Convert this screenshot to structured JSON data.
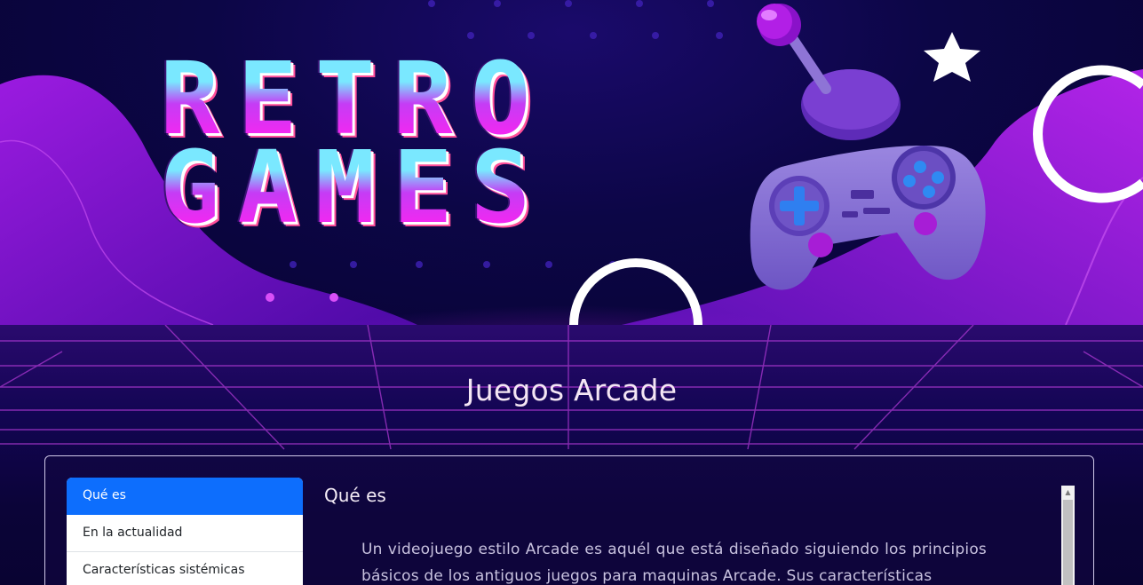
{
  "hero": {
    "logo_line1": "RETRO",
    "logo_line2": "GAMES"
  },
  "section": {
    "title": "Juegos Arcade"
  },
  "sidebar": {
    "items": [
      {
        "label": "Qué es",
        "active": true
      },
      {
        "label": "En la actualidad",
        "active": false
      },
      {
        "label": "Características sistémicas",
        "active": false
      }
    ]
  },
  "content": {
    "heading": "Qué es",
    "paragraph": "Un videojuego estilo Arcade es aquél que está diseñado siguiendo los principios básicos de los antiguos juegos para maquinas Arcade. Sus características"
  },
  "colors": {
    "accent": "#0d6efd",
    "background": "#0b0533",
    "neon_magenta": "#ff22f0",
    "neon_cyan": "#7ae8ff"
  }
}
